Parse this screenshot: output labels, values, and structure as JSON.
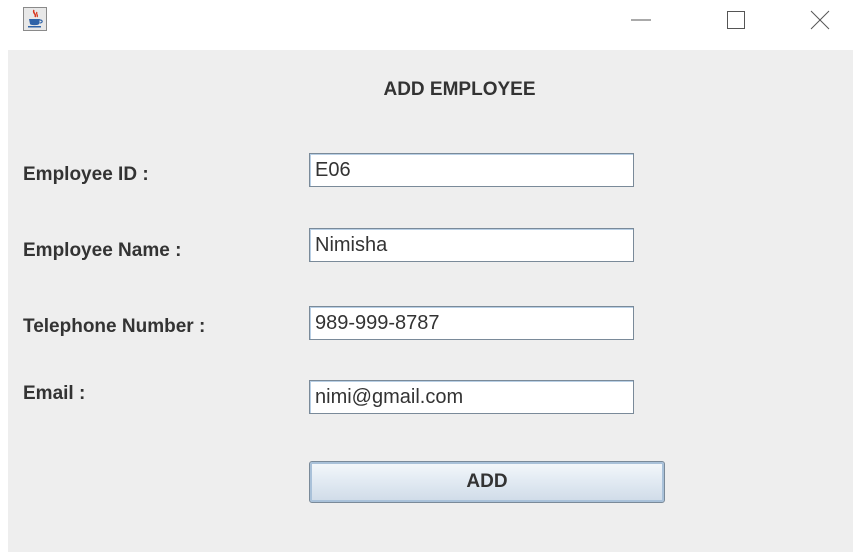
{
  "window": {
    "icons": {
      "app": "java-cup-icon",
      "minimize": "minimize-icon",
      "maximize": "maximize-icon",
      "close": "close-icon"
    }
  },
  "form": {
    "heading": "ADD EMPLOYEE",
    "fields": [
      {
        "label": "Employee ID :",
        "value": "E06"
      },
      {
        "label": "Employee Name :",
        "value": "Nimisha"
      },
      {
        "label": "Telephone Number :",
        "value": "989-999-8787"
      },
      {
        "label": "Email :",
        "value": "nimi@gmail.com"
      }
    ],
    "submit_label": "ADD"
  },
  "colors": {
    "panel": "#eeeeee",
    "text": "#333333",
    "button_top": "#f5f8fb",
    "button_bottom": "#cfdbe8"
  }
}
